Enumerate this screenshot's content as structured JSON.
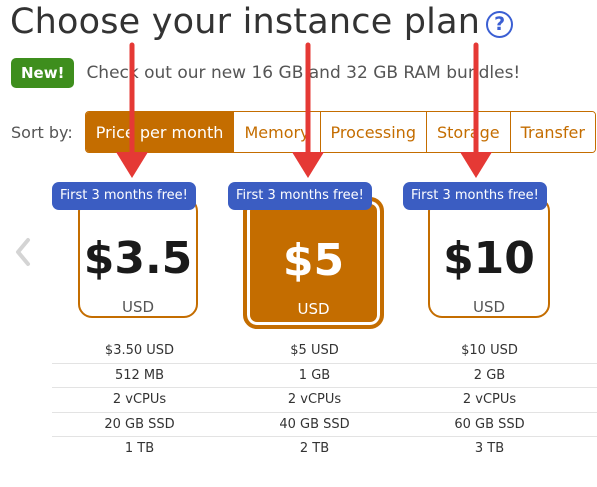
{
  "header": {
    "title": "Choose your instance plan",
    "help_icon": "question-mark-circle-icon"
  },
  "banner": {
    "badge": "New!",
    "text": "Check out our new 16 GB and 32 GB RAM bundles!"
  },
  "sort": {
    "label": "Sort by:",
    "tabs": [
      {
        "label": "Price per month",
        "active": true
      },
      {
        "label": "Memory",
        "active": false
      },
      {
        "label": "Processing",
        "active": false
      },
      {
        "label": "Storage",
        "active": false
      },
      {
        "label": "Transfer",
        "active": false
      }
    ]
  },
  "carousel": {
    "prev_icon": "chevron-left-icon"
  },
  "plans": [
    {
      "badge": "First 3 months free!",
      "price": "$3.5",
      "currency": "USD",
      "selected": false,
      "specs": [
        "$3.50 USD",
        "512 MB",
        "2 vCPUs",
        "20 GB SSD",
        "1 TB"
      ]
    },
    {
      "badge": "First 3 months free!",
      "price": "$5",
      "currency": "USD",
      "selected": true,
      "specs": [
        "$5 USD",
        "1 GB",
        "2 vCPUs",
        "40 GB SSD",
        "2 TB"
      ]
    },
    {
      "badge": "First 3 months free!",
      "price": "$10",
      "currency": "USD",
      "selected": false,
      "specs": [
        "$10 USD",
        "2 GB",
        "2 vCPUs",
        "60 GB SSD",
        "3 TB"
      ]
    }
  ],
  "colors": {
    "accent": "#c46d00",
    "badge_blue": "#3b5dc2",
    "new_green": "#3e8e1d",
    "annotation_arrow": "#e53935"
  }
}
